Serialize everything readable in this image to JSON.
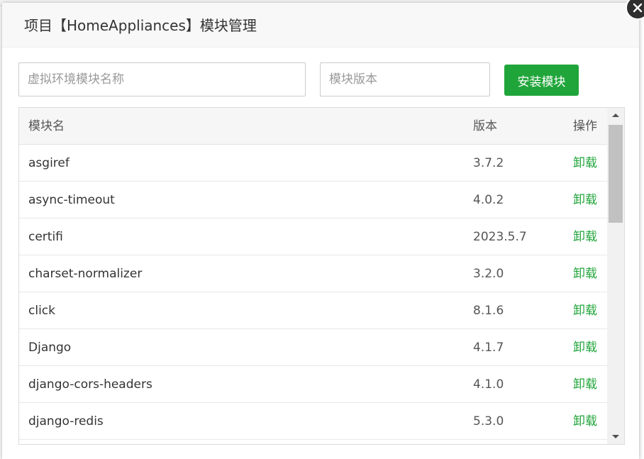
{
  "dialog": {
    "title": "项目【HomeAppliances】模块管理",
    "close_icon": "close-icon"
  },
  "form": {
    "name_placeholder": "虚拟环境模块名称",
    "name_value": "",
    "version_placeholder": "模块版本",
    "version_value": "",
    "install_label": "安装模块"
  },
  "table": {
    "headers": {
      "name": "模块名",
      "version": "版本",
      "action": "操作"
    },
    "rows": [
      {
        "name": "asgiref",
        "version": "3.7.2",
        "action": "卸载"
      },
      {
        "name": "async-timeout",
        "version": "4.0.2",
        "action": "卸载"
      },
      {
        "name": "certifi",
        "version": "2023.5.7",
        "action": "卸载"
      },
      {
        "name": "charset-normalizer",
        "version": "3.2.0",
        "action": "卸载"
      },
      {
        "name": "click",
        "version": "8.1.6",
        "action": "卸载"
      },
      {
        "name": "Django",
        "version": "4.1.7",
        "action": "卸载"
      },
      {
        "name": "django-cors-headers",
        "version": "4.1.0",
        "action": "卸载"
      },
      {
        "name": "django-redis",
        "version": "5.3.0",
        "action": "卸载"
      },
      {
        "name": "",
        "version": "",
        "action": ""
      }
    ]
  },
  "colors": {
    "accent": "#20a53a",
    "header_bg": "#f8f8f8",
    "table_head_bg": "#f6f6f6"
  }
}
